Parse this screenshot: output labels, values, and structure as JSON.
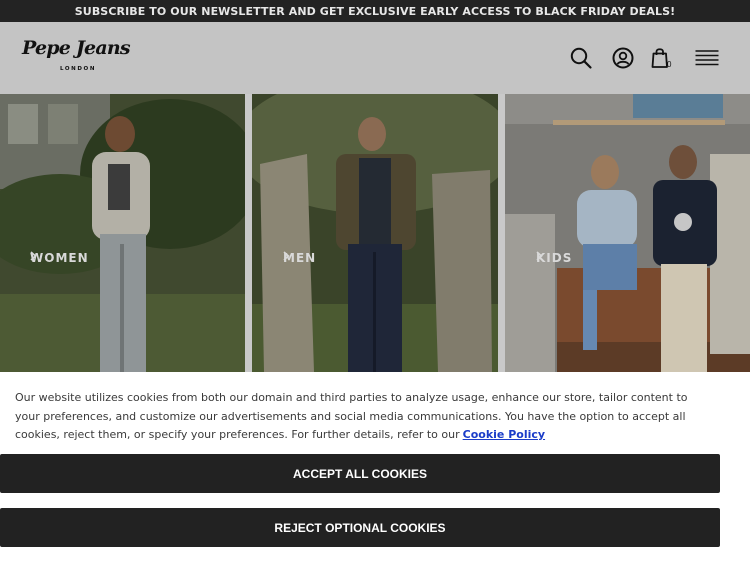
{
  "announcement": {
    "text": "SUBSCRIBE TO OUR NEWSLETTER AND GET EXCLUSIVE EARLY ACCESS TO BLACK FRIDAY DEALS!"
  },
  "header": {
    "logo": {
      "script": "Pepe Jeans",
      "sub": "LONDON"
    },
    "icons": [
      "search-icon",
      "account-icon",
      "shopping-bag-icon",
      "hamburger-menu-icon"
    ],
    "cart_count": "0"
  },
  "hero": {
    "panels": [
      {
        "label": "WOMEN"
      },
      {
        "label": "MEN"
      },
      {
        "label": "KIDS"
      }
    ]
  },
  "cookie_banner": {
    "text": "Our website utilizes cookies from both our domain and third parties to analyze usage, enhance our store, tailor content to your preferences, and customize our advertisements and social media communications. You have the option to accept all cookies, reject them, or specify your preferences. For further details, refer to our",
    "link": "Cookie Policy",
    "accept_label": "ACCEPT ALL COOKIES",
    "reject_label": "REJECT OPTIONAL COOKIES"
  },
  "colors": {
    "topbar_bg": "#232323",
    "header_bg": "#c4c4c4",
    "button_bg": "#222222",
    "link": "#1a3cc8"
  }
}
